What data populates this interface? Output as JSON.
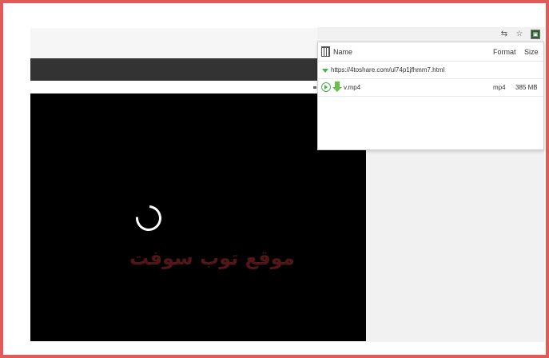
{
  "toolbar": {
    "translate_icon": "translate-icon",
    "star_icon": "star-icon",
    "extension_icon": "video-downloader-extension-icon"
  },
  "popup": {
    "columns": {
      "name": "Name",
      "format": "Format",
      "size": "Size"
    },
    "page_url": "https://4toshare.com/ul74p1jfhmm7.html",
    "files": [
      {
        "name": "v.mp4",
        "format": "mp4",
        "size": "385 MB"
      }
    ]
  },
  "video": {
    "watermark": "موقع توب سوفت"
  },
  "colors": {
    "frame_border": "#e05a5a",
    "accent_green": "#4caf50",
    "dark_header": "#333333"
  }
}
